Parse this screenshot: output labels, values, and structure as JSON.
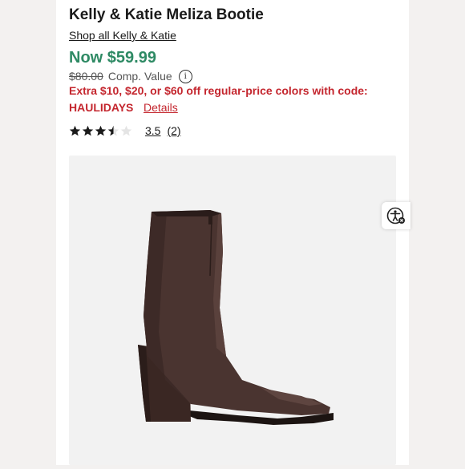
{
  "product": {
    "title": "Kelly & Katie Meliza Bootie",
    "shop_link": "Shop all Kelly & Katie"
  },
  "price": {
    "now": "Now $59.99",
    "original": "$80.00",
    "comp_label": "Comp. Value",
    "info_icon": "info-icon"
  },
  "promo": {
    "text": "Extra $10, $20, or $60 off regular-price colors with code:",
    "code": "HAULIDAYS",
    "details_link": "Details"
  },
  "rating": {
    "stars": 3.5,
    "max_stars": 5,
    "value_label": "3.5",
    "count_label": "(2)"
  },
  "image": {
    "subject": "product-photo-boot"
  },
  "accessibility_button": {
    "icon": "accessibility-icon"
  },
  "colors": {
    "price_green": "#2e8a64",
    "promo_red": "#c4262e",
    "boot_brown": "#4a3430"
  }
}
